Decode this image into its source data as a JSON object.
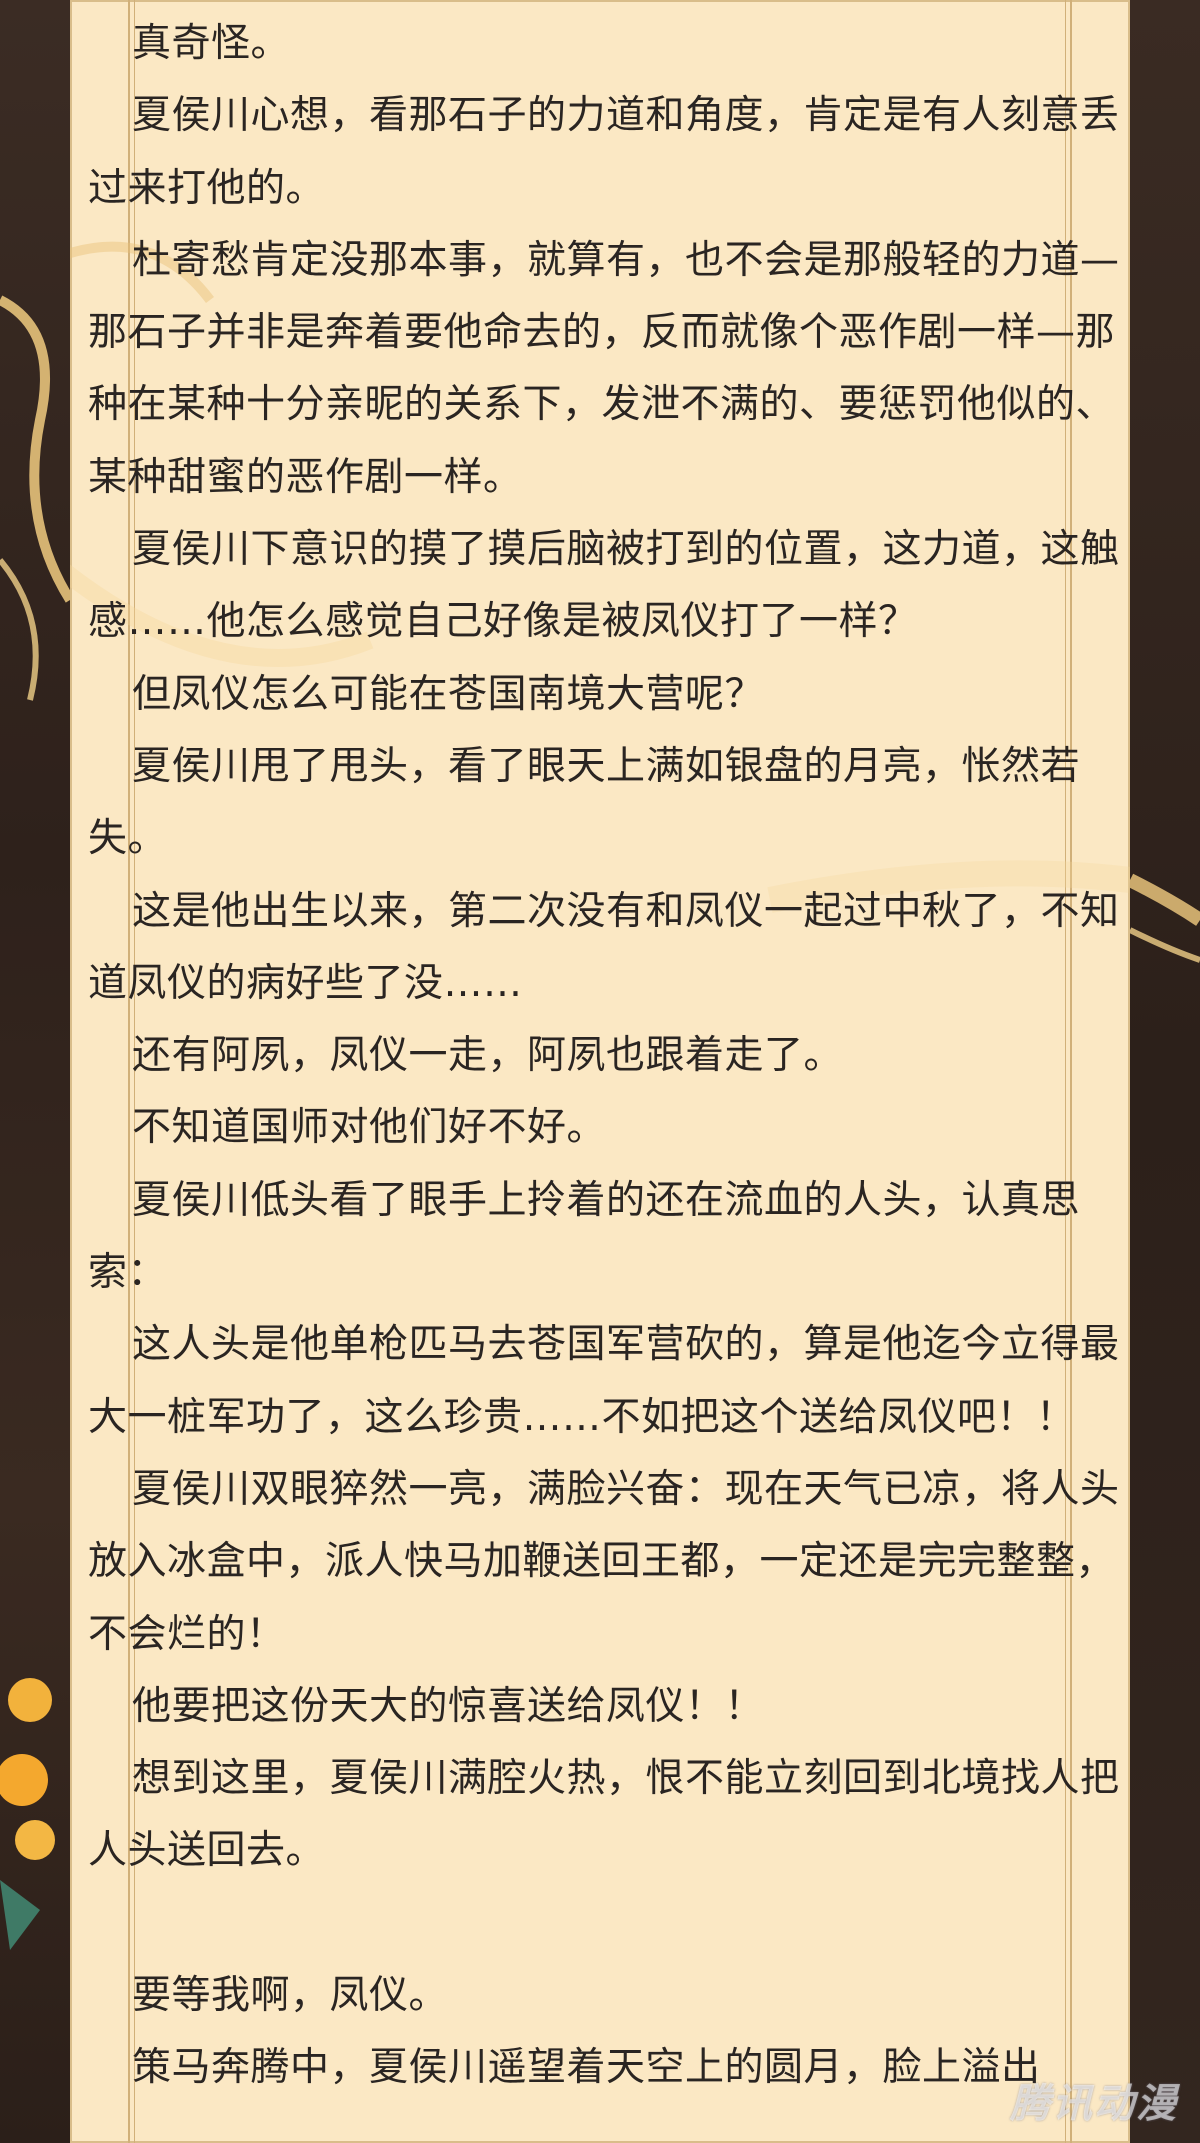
{
  "paragraphs": [
    "真奇怪。",
    "夏侯川心想，看那石子的力道和角度，肯定是有人刻意丢过来打他的。",
    "杜寄愁肯定没那本事，就算有，也不会是那般轻的力道—那石子并非是奔着要他命去的，反而就像个恶作剧一样—那种在某种十分亲昵的关系下，发泄不满的、要惩罚他似的、某种甜蜜的恶作剧一样。",
    "夏侯川下意识的摸了摸后脑被打到的位置，这力道，这触感……他怎么感觉自己好像是被凤仪打了一样？",
    "但凤仪怎么可能在苍国南境大营呢？",
    "夏侯川甩了甩头，看了眼天上满如银盘的月亮，怅然若失。",
    "这是他出生以来，第二次没有和凤仪一起过中秋了，不知道凤仪的病好些了没……",
    "还有阿夙，凤仪一走，阿夙也跟着走了。",
    "不知道国师对他们好不好。",
    "夏侯川低头看了眼手上拎着的还在流血的人头，认真思索：",
    "这人头是他单枪匹马去苍国军营砍的，算是他迄今立得最大一桩军功了，这么珍贵……不如把这个送给凤仪吧！！",
    "夏侯川双眼猝然一亮，满脸兴奋：现在天气已凉，将人头放入冰盒中，派人快马加鞭送回王都，一定还是完完整整，不会烂的！",
    "他要把这份天大的惊喜送给凤仪！！",
    "想到这里，夏侯川满腔火热，恨不能立刻回到北境找人把人头送回去。",
    "",
    "要等我啊，凤仪。",
    "策马奔腾中，夏侯川遥望着天空上的圆月，脸上溢出"
  ],
  "watermark": "腾讯动漫",
  "colors": {
    "paper": "#fbe8c4",
    "text": "#2a2522",
    "border": "#d1b079",
    "side": "#2e211b"
  }
}
